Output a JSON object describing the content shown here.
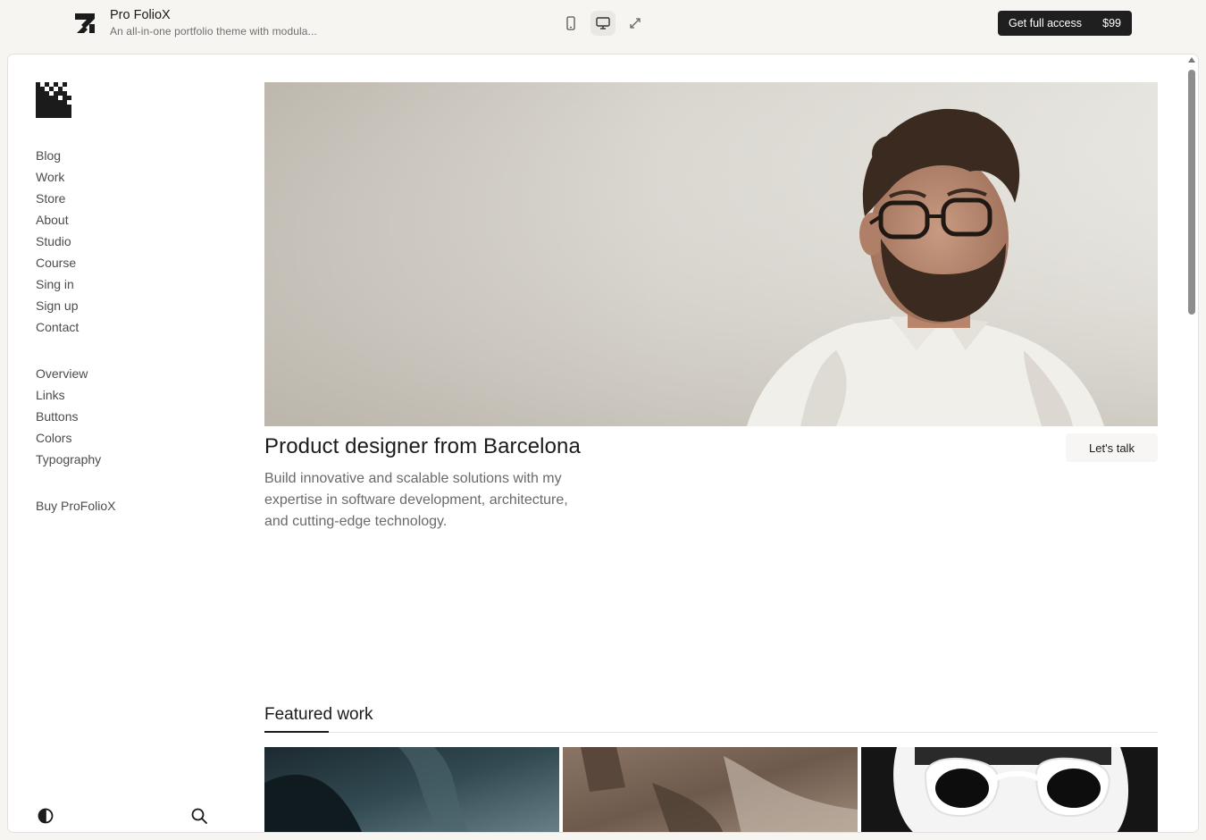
{
  "topbar": {
    "title": "Pro FolioX",
    "subtitle": "An all-in-one portfolio theme with modula...",
    "cta_label": "Get full access",
    "cta_price": "$99",
    "devices": [
      "mobile-icon",
      "desktop-icon",
      "expand-icon"
    ],
    "active_device": "desktop-icon"
  },
  "sidebar": {
    "nav_main": [
      "Blog",
      "Work",
      "Store",
      "About",
      "Studio",
      "Course",
      "Sing in",
      "Sign up",
      "Contact"
    ],
    "nav_ui": [
      "Overview",
      "Links",
      "Buttons",
      "Colors",
      "Typography"
    ],
    "buy_label": "Buy ProFolioX",
    "bottom_icons": [
      "contrast-icon",
      "search-icon"
    ]
  },
  "hero": {
    "title": "Product designer from Barcelona",
    "button_label": "Let's talk",
    "description": "Build innovative and scalable solutions with my expertise in software development, architecture, and cutting-edge technology."
  },
  "featured": {
    "heading": "Featured work"
  },
  "colors": {
    "page_bg": "#f7f5f2",
    "frame_bg": "#ffffff",
    "cta_bg": "#1f1f1f",
    "text_primary": "#1b1b1b",
    "text_muted": "#6a6a6a"
  }
}
